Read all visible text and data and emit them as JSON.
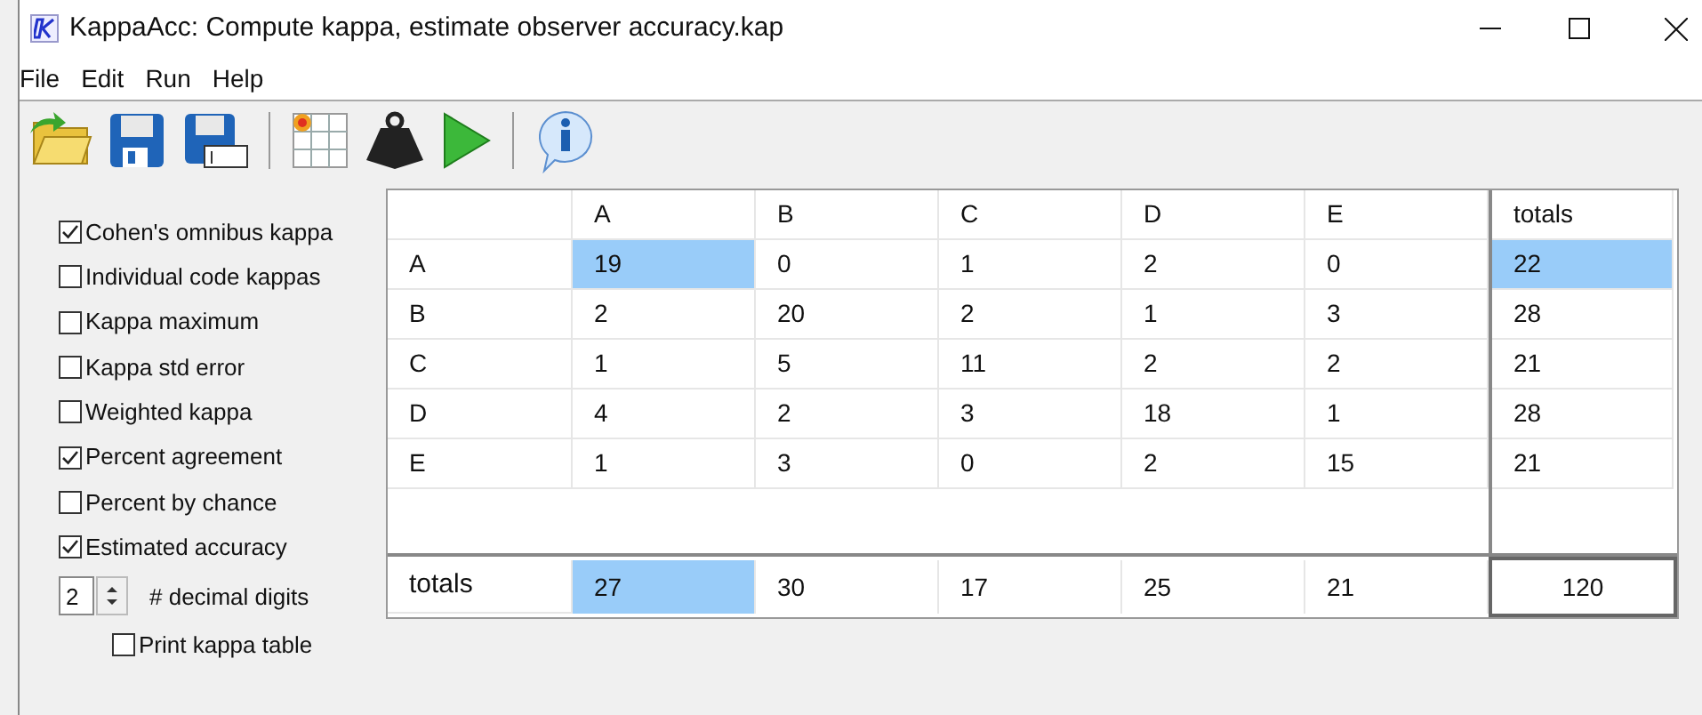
{
  "window": {
    "title": "KappaAcc: Compute kappa, estimate observer accuracy.kap"
  },
  "menu": [
    "File",
    "Edit",
    "Run",
    "Help"
  ],
  "toolbar": [
    {
      "kind": "open"
    },
    {
      "kind": "save"
    },
    {
      "kind": "saveas"
    },
    {
      "kind": "sep"
    },
    {
      "kind": "grid"
    },
    {
      "kind": "weight"
    },
    {
      "kind": "run"
    },
    {
      "kind": "sep"
    },
    {
      "kind": "info"
    }
  ],
  "options": [
    {
      "label": "Cohen's omnibus kappa",
      "checked": true
    },
    {
      "label": "Individual code kappas",
      "checked": false
    },
    {
      "label": "Kappa maximum",
      "checked": false
    },
    {
      "label": "Kappa std error",
      "checked": false
    },
    {
      "label": "Weighted kappa",
      "checked": false
    },
    {
      "label": "Percent agreement",
      "checked": true
    },
    {
      "label": "Percent by chance",
      "checked": false
    },
    {
      "label": "Estimated accuracy",
      "checked": true
    }
  ],
  "decimal_digits": {
    "value": "2",
    "label": "# decimal digits"
  },
  "print_kappa_table": {
    "label": "Print kappa table",
    "checked": false
  },
  "table": {
    "columns": [
      "A",
      "B",
      "C",
      "D",
      "E"
    ],
    "totals_heading": "totals",
    "rows": [
      {
        "label": "A",
        "cells": [
          {
            "value": "19",
            "selected": true
          },
          {
            "value": "0",
            "selected": false
          },
          {
            "value": "1",
            "selected": false
          },
          {
            "value": "2",
            "selected": false
          },
          {
            "value": "0",
            "selected": false
          }
        ],
        "total": {
          "value": "22",
          "selected": true
        }
      },
      {
        "label": "B",
        "cells": [
          {
            "value": "2",
            "selected": false
          },
          {
            "value": "20",
            "selected": false
          },
          {
            "value": "2",
            "selected": false
          },
          {
            "value": "1",
            "selected": false
          },
          {
            "value": "3",
            "selected": false
          }
        ],
        "total": {
          "value": "28",
          "selected": false
        }
      },
      {
        "label": "C",
        "cells": [
          {
            "value": "1",
            "selected": false
          },
          {
            "value": "5",
            "selected": false
          },
          {
            "value": "11",
            "selected": false
          },
          {
            "value": "2",
            "selected": false
          },
          {
            "value": "2",
            "selected": false
          }
        ],
        "total": {
          "value": "21",
          "selected": false
        }
      },
      {
        "label": "D",
        "cells": [
          {
            "value": "4",
            "selected": false
          },
          {
            "value": "2",
            "selected": false
          },
          {
            "value": "3",
            "selected": false
          },
          {
            "value": "18",
            "selected": false
          },
          {
            "value": "1",
            "selected": false
          }
        ],
        "total": {
          "value": "28",
          "selected": false
        }
      },
      {
        "label": "E",
        "cells": [
          {
            "value": "1",
            "selected": false
          },
          {
            "value": "3",
            "selected": false
          },
          {
            "value": "0",
            "selected": false
          },
          {
            "value": "2",
            "selected": false
          },
          {
            "value": "15",
            "selected": false
          }
        ],
        "total": {
          "value": "21",
          "selected": false
        }
      }
    ],
    "totals_row": {
      "label": "totals",
      "cells": [
        {
          "value": "27",
          "selected": true
        },
        {
          "value": "30",
          "selected": false
        },
        {
          "value": "17",
          "selected": false
        },
        {
          "value": "25",
          "selected": false
        },
        {
          "value": "21",
          "selected": false
        }
      ]
    },
    "grand_total": "120"
  }
}
